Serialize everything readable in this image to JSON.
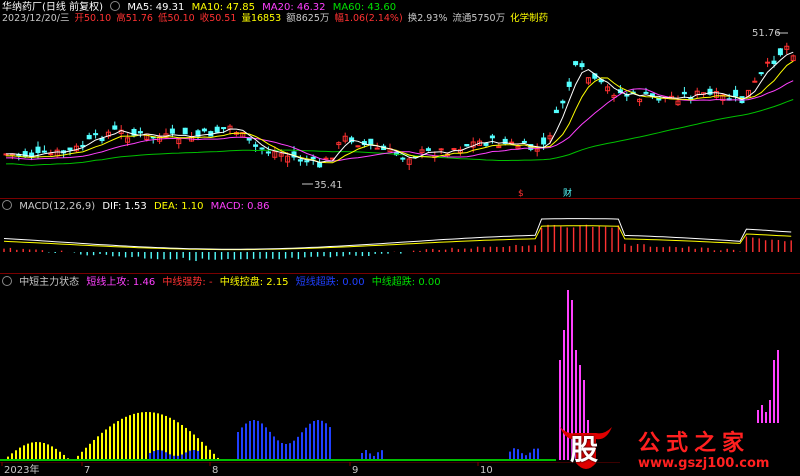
{
  "header": {
    "title": "华纳药厂(日线 前复权)",
    "ma": {
      "ma5": "MA5: 49.31",
      "ma10": "MA10: 47.85",
      "ma20": "MA20: 46.32",
      "ma60": "MA60: 43.60"
    },
    "date": "2023/12/20/三",
    "open": "开50.10",
    "high": "高51.76",
    "low": "低50.10",
    "close": "收50.51",
    "volume": "量16853",
    "amount": "额8625万",
    "change": "幅1.06(2.14%)",
    "turnover": "换2.93%",
    "float": "流通5750万",
    "sector": "化学制药",
    "price_high": "51.76",
    "price_low": "35.41"
  },
  "markers": {
    "dividend": "$",
    "finance": "财"
  },
  "macd": {
    "title": "MACD(12,26,9)",
    "dif": "DIF: 1.53",
    "dea": "DEA: 1.10",
    "macd": "MACD: 0.86"
  },
  "indicator": {
    "title": "中短主力状态",
    "short_attack": "短线上攻: 1.46",
    "mid_strong": "中线强势: -",
    "mid_control": "中线控盘: 2.15",
    "short_top": "短线超跌: 0.00",
    "mid_top": "中线超跌: 0.00"
  },
  "xaxis": {
    "labels": [
      "2023年",
      "7",
      "8",
      "9",
      "10"
    ]
  },
  "watermark": {
    "logo": "股",
    "text": "公式之家",
    "url": "www.gszj100.com"
  },
  "colors": {
    "up": "#ff3232",
    "down": "#54ffff",
    "ma5": "#ffffff",
    "ma10": "#ffff00",
    "ma20": "#ff40ff",
    "ma60": "#00c000",
    "bg": "#000000"
  }
}
